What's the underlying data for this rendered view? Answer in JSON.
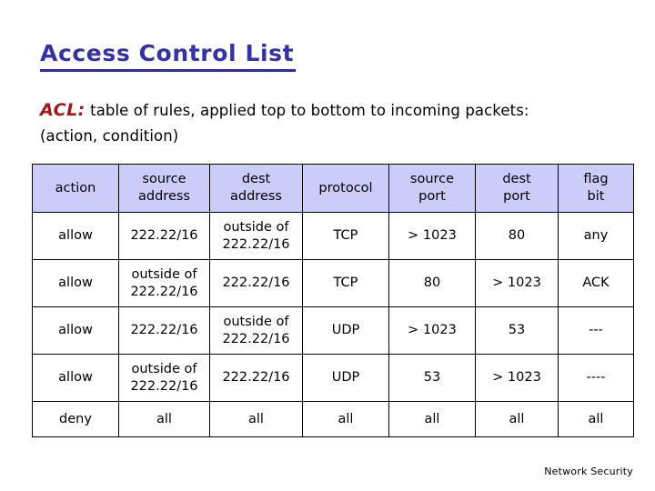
{
  "slide": {
    "title": "Access Control List",
    "intro": {
      "label": "ACL:",
      "line1": "table of rules, applied top to bottom to incoming packets:",
      "line2": "(action, condition)"
    },
    "footer": "Network Security",
    "colors": {
      "title": "#3333a6",
      "title_underline": "#2e2e96",
      "acl_label": "#a01818",
      "header_background": "#ccccfa",
      "border": "#000000",
      "text": "#000000"
    }
  },
  "table": {
    "headers": [
      {
        "line1": "action",
        "line2": ""
      },
      {
        "line1": "source",
        "line2": "address"
      },
      {
        "line1": "dest",
        "line2": "address"
      },
      {
        "line1": "protocol",
        "line2": ""
      },
      {
        "line1": "source",
        "line2": "port"
      },
      {
        "line1": "dest",
        "line2": "port"
      },
      {
        "line1": "flag",
        "line2": "bit"
      }
    ],
    "rows": [
      {
        "action": "allow",
        "source_address_line1": "222.22/16",
        "source_address_line2": "",
        "dest_address_line1": "outside of",
        "dest_address_line2": "222.22/16",
        "protocol": "TCP",
        "source_port": "> 1023",
        "dest_port": "80",
        "flag_bit": "any"
      },
      {
        "action": "allow",
        "source_address_line1": "outside of",
        "source_address_line2": "222.22/16",
        "dest_address_line1": "222.22/16",
        "dest_address_line2": "",
        "protocol": "TCP",
        "source_port": "80",
        "dest_port": "> 1023",
        "flag_bit": "ACK"
      },
      {
        "action": "allow",
        "source_address_line1": "222.22/16",
        "source_address_line2": "",
        "dest_address_line1": "outside of",
        "dest_address_line2": "222.22/16",
        "protocol": "UDP",
        "source_port": "> 1023",
        "dest_port": "53",
        "flag_bit": "---"
      },
      {
        "action": "allow",
        "source_address_line1": "outside of",
        "source_address_line2": "222.22/16",
        "dest_address_line1": "222.22/16",
        "dest_address_line2": "",
        "protocol": "UDP",
        "source_port": "53",
        "dest_port": "> 1023",
        "flag_bit": "----"
      },
      {
        "action": "deny",
        "source_address_line1": "all",
        "source_address_line2": "",
        "dest_address_line1": "all",
        "dest_address_line2": "",
        "protocol": "all",
        "source_port": "all",
        "dest_port": "all",
        "flag_bit": "all"
      }
    ]
  }
}
